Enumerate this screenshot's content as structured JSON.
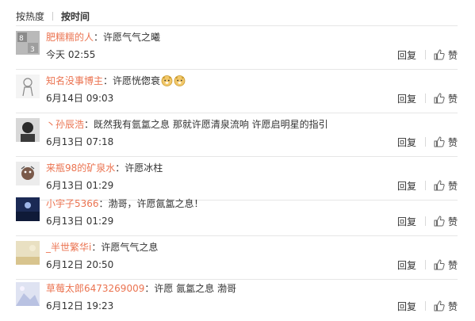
{
  "sort": {
    "hot_label": "按热度",
    "time_label": "按时间"
  },
  "actions": {
    "reply_label": "回复",
    "like_label": "赞"
  },
  "comments": [
    {
      "user": "肥糯糯的人",
      "text": "：许愿气气之曦",
      "time": "今天 02:55"
    },
    {
      "user": "知名没事博主",
      "text": "：许愿恍偬衰",
      "time": "6月14日 09:03",
      "emoji_after": "doge-icon x2"
    },
    {
      "user": "丶孙辰浩",
      "text": "：既然我有氩氲之息 那就许愿清泉流响 许愿启明星的指引",
      "time": "6月13日 07:18"
    },
    {
      "user": "来瓶98的矿泉水",
      "text": "：许愿冰柱",
      "time": "6月13日 01:29"
    },
    {
      "user": "小宇子5366",
      "text": "：渤哥，许愿氤氲之息！",
      "time": "6月13日 01:29"
    },
    {
      "user": "_半世繁华i",
      "text": "：许愿气气之息",
      "time": "6月12日 20:50"
    },
    {
      "user": "草莓太郎6473269009",
      "text": "：许愿 氤氲之息 渤哥",
      "time": "6月12日 19:23"
    }
  ],
  "colors": {
    "username": "#eb7350",
    "text": "#333333",
    "divider": "#e6e6e6"
  }
}
